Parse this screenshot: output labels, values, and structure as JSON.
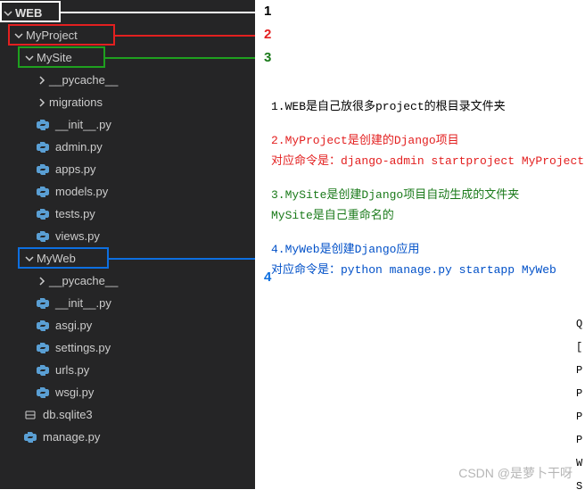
{
  "tree": {
    "root": "WEB",
    "l1": "MyProject",
    "l2": "MySite",
    "items_l3a": [
      "__pycache__",
      "migrations"
    ],
    "files_l3a": [
      "__init__.py",
      "admin.py",
      "apps.py",
      "models.py",
      "tests.py",
      "views.py"
    ],
    "myweb": "MyWeb",
    "items_l3b": [
      "__pycache__"
    ],
    "files_l3b": [
      "__init__.py",
      "asgi.py",
      "settings.py",
      "urls.py",
      "wsgi.py"
    ],
    "db": "db.sqlite3",
    "manage": "manage.py"
  },
  "annotations": {
    "n1": "1",
    "n2": "2",
    "n3": "3",
    "n4": "4"
  },
  "notes": {
    "p1": "1.WEB是自己放很多project的根目录文件夹",
    "p2a": "2.MyProject是创建的Django项目",
    "p2b": "对应命令是：django-admin startproject MyProject",
    "p3a": "3.MySite是创建Django项目自动生成的文件夹",
    "p3b": "MySite是自己重命名的",
    "p4a": "4.MyWeb是创建Django应用",
    "p4b": "对应命令是：python manage.py startapp MyWeb"
  },
  "watermark": "CSDN @是萝卜干呀",
  "cutcol": [
    "Q",
    "[",
    "P",
    "P",
    "P",
    "P",
    "W",
    "S"
  ]
}
